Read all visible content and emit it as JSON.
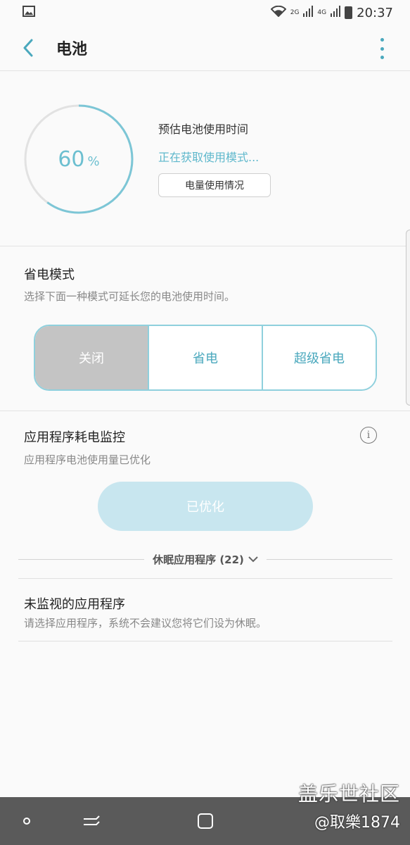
{
  "status_bar": {
    "time": "20:37",
    "network_2g": "2G",
    "network_4g": "4G",
    "icons": [
      "image-icon",
      "wifi-icon",
      "signal-icon",
      "signal-icon",
      "battery-icon"
    ]
  },
  "app_bar": {
    "title": "电池",
    "back_icon": "chevron-left-icon",
    "more_icon": "more-vertical-icon"
  },
  "battery": {
    "level": 60,
    "level_text": "60",
    "percent_sign": "%",
    "estimate_label": "预估电池使用时间",
    "mode_status": "正在获取使用模式...",
    "usage_button": "电量使用情况"
  },
  "power_saving": {
    "title": "省电模式",
    "description": "选择下面一种模式可延长您的电池使用时间。",
    "modes": [
      "关闭",
      "省电",
      "超级省电"
    ],
    "selected": "关闭"
  },
  "app_monitor": {
    "title": "应用程序耗电监控",
    "description": "应用程序电池使用量已优化",
    "info_icon": "info-icon",
    "optimized_button": "已优化",
    "sleeping_apps": "休眠应用程序 (22)"
  },
  "unmonitored": {
    "title": "未监视的应用程序",
    "description": "请选择应用程序，系统不会建议您将它们设为休眠。"
  },
  "watermark": {
    "title": "盖乐世社区",
    "user": "@取樂1874"
  },
  "colors": {
    "accent": "#4aa8bd",
    "gauge": "#7cc6d6",
    "selected_segment": "#c4c4c4",
    "nav_bar": "#5a5a5a"
  }
}
